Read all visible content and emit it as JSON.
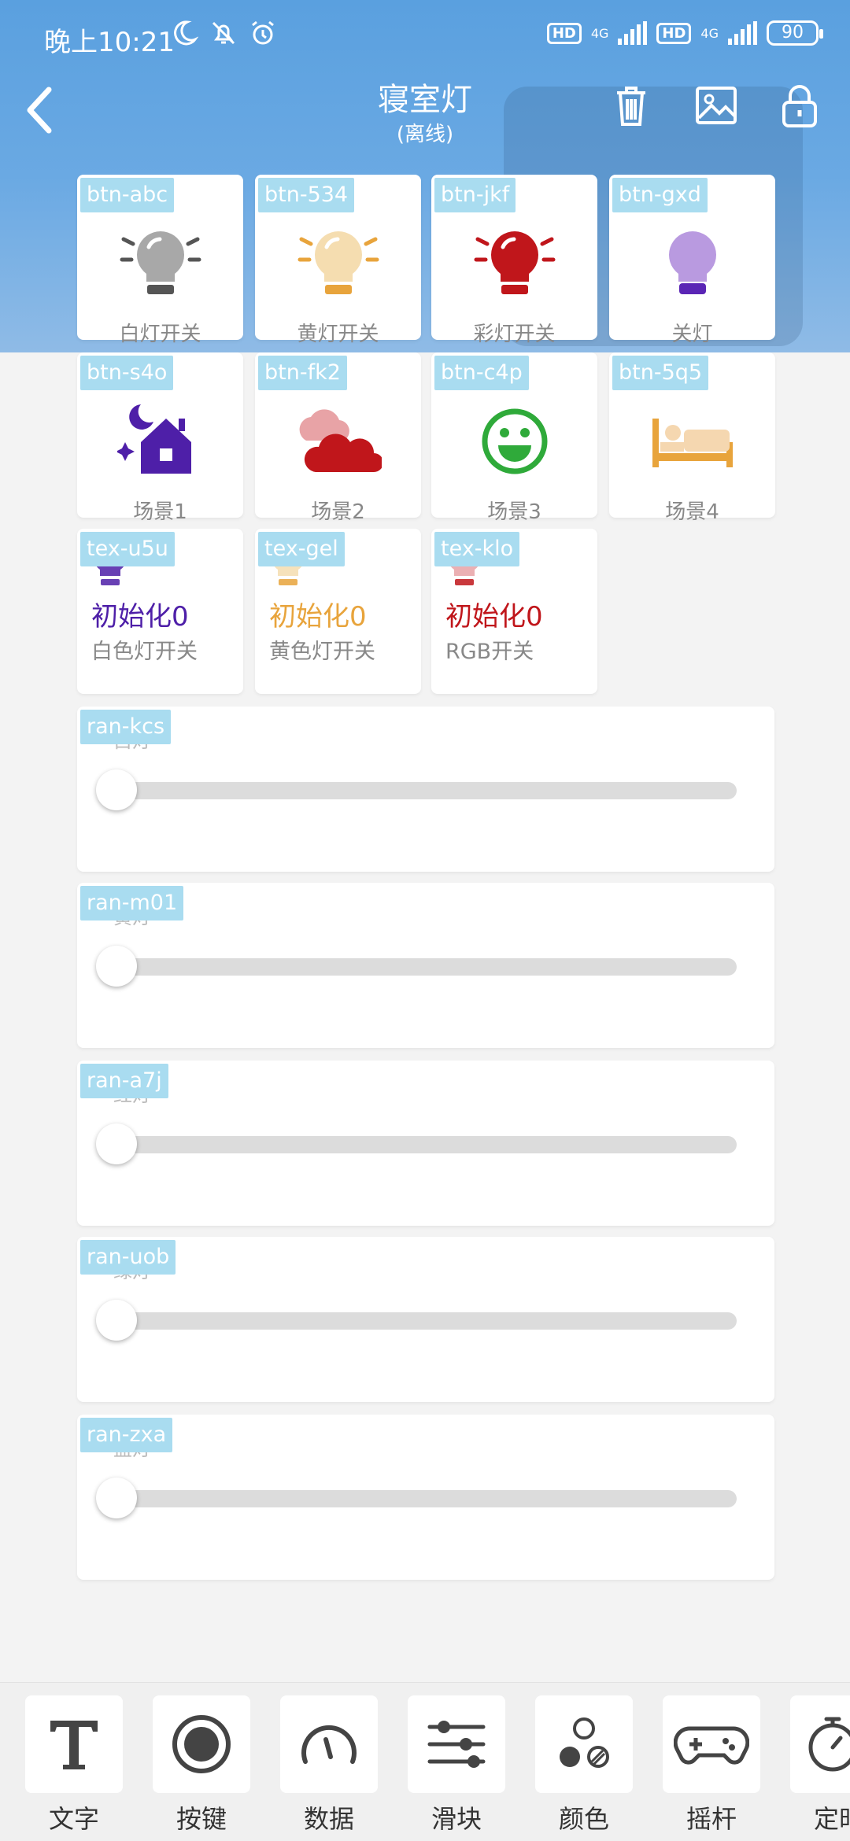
{
  "status_bar": {
    "time": "晚上10:21",
    "hd1": "HD",
    "net1": "4G",
    "hd2": "HD",
    "net2": "4G",
    "battery": "90"
  },
  "header": {
    "title": "寝室灯",
    "subtitle": "(离线)"
  },
  "buttons": [
    {
      "tag": "btn-abc",
      "label": "白灯开关",
      "icon": "bulb-icon",
      "color": "#a8a8a8"
    },
    {
      "tag": "btn-534",
      "label": "黄灯开关",
      "icon": "bulb-icon",
      "color": "#f5ddb0"
    },
    {
      "tag": "btn-jkf",
      "label": "彩灯开关",
      "icon": "bulb-icon",
      "color": "#c0161b"
    },
    {
      "tag": "btn-gxd",
      "label": "关灯",
      "icon": "bulb-off-icon",
      "color": "#b99ae0"
    },
    {
      "tag": "btn-s4o",
      "label": "场景1",
      "icon": "night-house-icon",
      "color": "#4e1fa8"
    },
    {
      "tag": "btn-fk2",
      "label": "场景2",
      "icon": "cloudy-icon",
      "color": "#c0161b"
    },
    {
      "tag": "btn-c4p",
      "label": "场景3",
      "icon": "smile-icon",
      "color": "#2faa3a"
    },
    {
      "tag": "btn-5q5",
      "label": "场景4",
      "icon": "bed-icon",
      "color": "#e8a43c"
    }
  ],
  "texts": [
    {
      "tag": "tex-u5u",
      "value": "初始化0",
      "label": "白色灯开关",
      "color": "#4e1fa8"
    },
    {
      "tag": "tex-gel",
      "value": "初始化0",
      "label": "黄色灯开关",
      "color": "#e8a43c"
    },
    {
      "tag": "tex-klo",
      "value": "初始化0",
      "label": "RGB开关",
      "color": "#c0161b"
    }
  ],
  "ranges": [
    {
      "tag": "ran-kcs",
      "label": "白灯",
      "value": 0
    },
    {
      "tag": "ran-m01",
      "label": "黄灯",
      "value": 0
    },
    {
      "tag": "ran-a7j",
      "label": "红灯",
      "value": 0
    },
    {
      "tag": "ran-uob",
      "label": "绿灯",
      "value": 0
    },
    {
      "tag": "ran-zxa",
      "label": "蓝灯",
      "value": 0
    }
  ],
  "toolbar": [
    {
      "label": "文字",
      "icon": "text-icon"
    },
    {
      "label": "按键",
      "icon": "button-icon"
    },
    {
      "label": "数据",
      "icon": "gauge-icon"
    },
    {
      "label": "滑块",
      "icon": "slider-icon"
    },
    {
      "label": "颜色",
      "icon": "color-icon"
    },
    {
      "label": "摇杆",
      "icon": "gamepad-icon"
    },
    {
      "label": "定时",
      "icon": "timer-icon"
    }
  ]
}
